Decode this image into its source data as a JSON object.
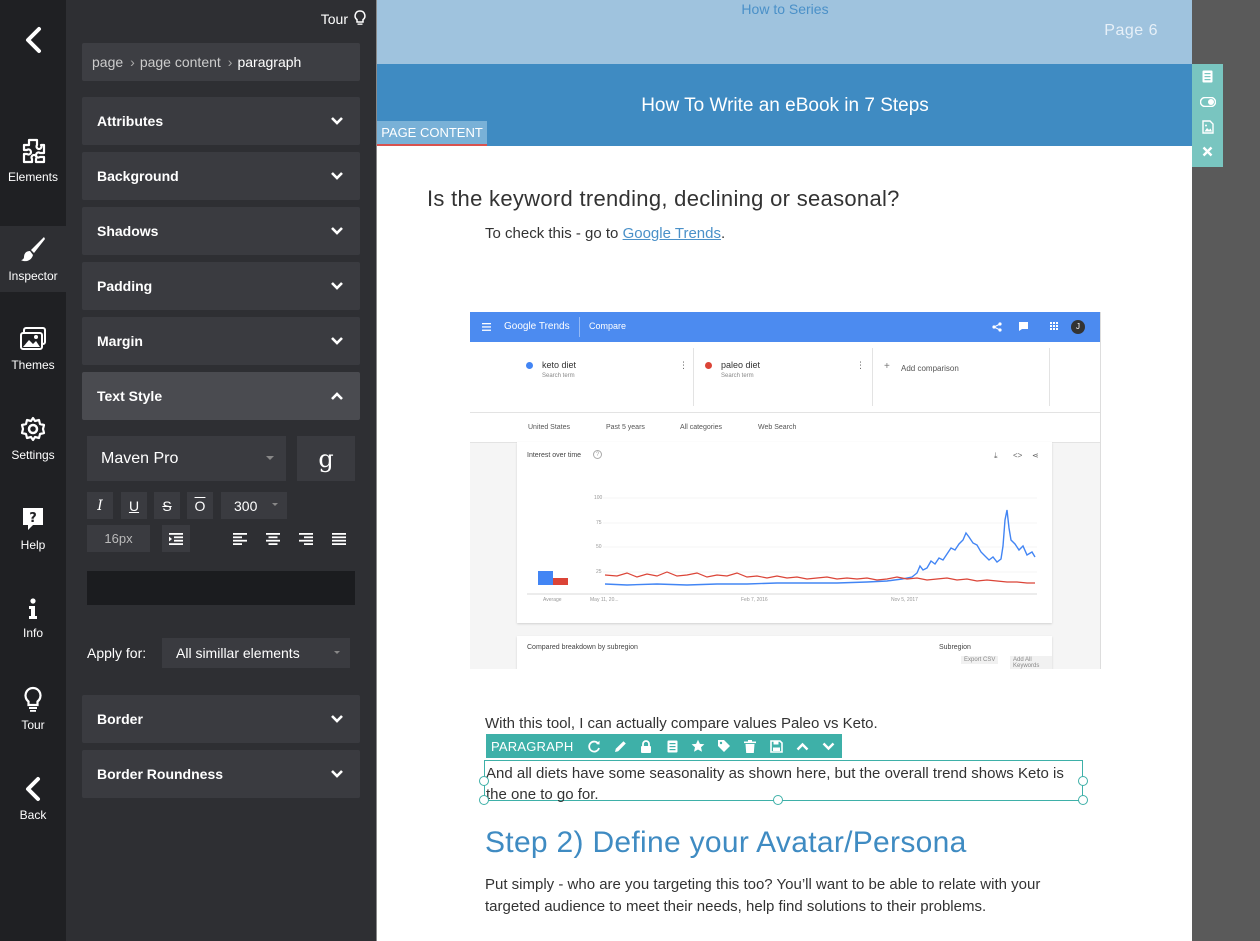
{
  "rail": {
    "items": [
      {
        "label": "Elements",
        "icon": "puzzle-icon"
      },
      {
        "label": "Inspector",
        "icon": "brush-icon"
      },
      {
        "label": "Themes",
        "icon": "images-icon"
      },
      {
        "label": "Settings",
        "icon": "gear-icon"
      },
      {
        "label": "Help",
        "icon": "help-bubble-icon"
      },
      {
        "label": "Info",
        "icon": "info-icon"
      },
      {
        "label": "Tour",
        "icon": "lightbulb-icon"
      },
      {
        "label": "Back",
        "icon": "chevron-left-icon"
      }
    ]
  },
  "inspector": {
    "tour_label": "Tour",
    "breadcrumb": [
      "page",
      "page content",
      "paragraph"
    ],
    "sections": {
      "attributes": "Attributes",
      "background": "Background",
      "shadows": "Shadows",
      "padding": "Padding",
      "margin": "Margin",
      "text_style": "Text Style",
      "border": "Border",
      "border_roundness": "Border Roundness"
    },
    "text_style": {
      "font_family": "Maven Pro",
      "google_font_glyph": "g",
      "italic": "I",
      "underline": "U",
      "strike": "S",
      "overline": "O",
      "weight": "300",
      "font_size": "16px"
    },
    "apply_for_label": "Apply for:",
    "apply_for_value": "All simillar elements"
  },
  "canvas": {
    "series_title": "How to Series",
    "page_number": "Page 6",
    "book_title": "How To Write an eBook in 7 Steps",
    "page_content_tag": "PAGE CONTENT",
    "question_heading": "Is the keyword trending, declining or seasonal?",
    "check_prefix": "To check this - go to ",
    "check_link": "Google Trends",
    "check_suffix": ".",
    "compare_text": "With this tool, I can actually compare values Paleo vs Keto.",
    "selected_text": "And all diets have some seasonality as shown here, but the overall trend shows Keto is the one to go for.",
    "step_heading": "Step 2) Define your Avatar/Persona",
    "put_text": "Put simply - who are you targeting this too? You’ll want to be able to relate with your targeted audience to meet their needs, help find solutions to their problems.",
    "toolbar_label": "PARAGRAPH",
    "trends": {
      "brand": "Google Trends",
      "tab": "Compare",
      "avatar_letter": "J",
      "term1": "keto diet",
      "term2": "paleo diet",
      "term_sub": "Search term",
      "add_comparison": "Add comparison",
      "filters": [
        "United States",
        "Past 5 years",
        "All categories",
        "Web Search"
      ],
      "chart_title": "Interest over time",
      "y_ticks": [
        "100",
        "75",
        "50",
        "25"
      ],
      "x_ticks": [
        "May 11, 20...",
        "Feb 7, 2016",
        "Nov 5, 2017"
      ],
      "average_label": "Average",
      "sub_title": "Compared breakdown by subregion",
      "sub_select": "Subregion",
      "export_csv": "Export CSV",
      "add_all": "Add All Keywords"
    }
  }
}
